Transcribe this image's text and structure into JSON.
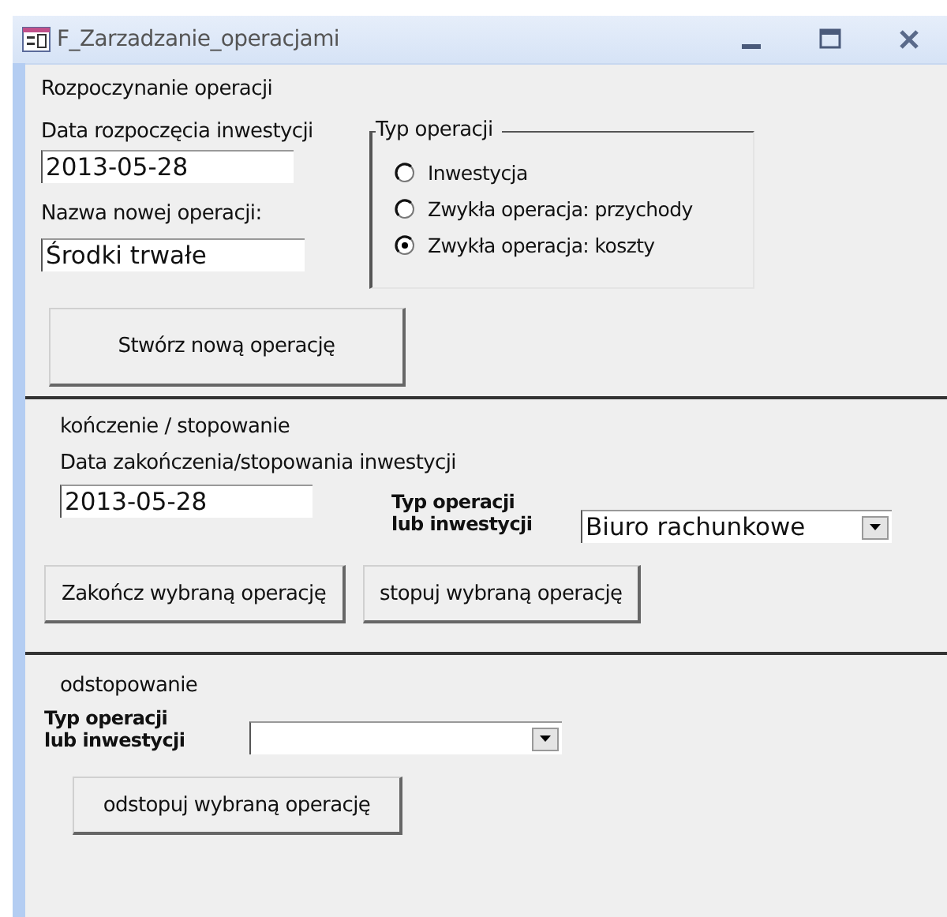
{
  "window": {
    "title": "F_Zarzadzanie_operacjami"
  },
  "start_section": {
    "title": "Rozpoczynanie operacji",
    "date_label": "Data rozpoczęcia inwestycji",
    "date_value": "2013-05-28",
    "name_label": "Nazwa nowej operacji:",
    "name_value": "Środki trwałe",
    "type_group": {
      "title": "Typ operacji",
      "options": [
        {
          "label": "Inwestycja",
          "selected": false
        },
        {
          "label": "Zwykła operacja: przychody",
          "selected": false
        },
        {
          "label": "Zwykła operacja: koszty",
          "selected": true
        }
      ]
    },
    "button": "Stwórz nową operację"
  },
  "end_section": {
    "title": "kończenie / stopowanie",
    "date_label": "Data zakończenia/stopowania inwestycji",
    "date_value": "2013-05-28",
    "type_label": [
      "Typ operacji",
      "lub inwestycji"
    ],
    "type_value": "Biuro rachunkowe",
    "buttons": [
      "Zakończ wybraną operację",
      "stopuj wybraną operację"
    ]
  },
  "resume_section": {
    "title": "odstopowanie",
    "type_label": [
      "Typ operacji",
      "lub inwestycji"
    ],
    "button": "odstopuj wybraną operację"
  }
}
